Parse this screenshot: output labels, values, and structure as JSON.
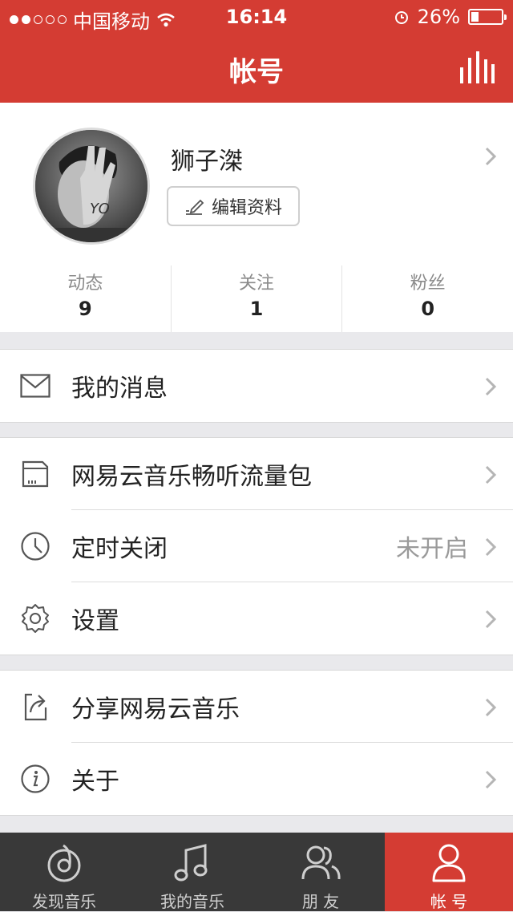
{
  "status_bar": {
    "carrier": "中国移动",
    "time": "16:14",
    "battery_percent": "26%",
    "battery_level": 0.26,
    "signal_bars_filled": 2,
    "signal_bars_total": 5
  },
  "nav": {
    "title": "帐号",
    "player_icon": "equalizer-icon"
  },
  "profile": {
    "username": "狮子滐",
    "edit_label": "编辑资料",
    "stats": [
      {
        "label": "动态",
        "value": "9"
      },
      {
        "label": "关注",
        "value": "1"
      },
      {
        "label": "粉丝",
        "value": "0"
      }
    ]
  },
  "menu": {
    "messages": {
      "label": "我的消息",
      "icon": "envelope-icon"
    },
    "data_pack": {
      "label": "网易云音乐畅听流量包",
      "icon": "sim-card-icon"
    },
    "sleep_timer": {
      "label": "定时关闭",
      "value": "未开启",
      "icon": "clock-icon"
    },
    "settings": {
      "label": "设置",
      "icon": "gear-icon"
    },
    "share": {
      "label": "分享网易云音乐",
      "icon": "share-icon"
    },
    "about": {
      "label": "关于",
      "icon": "info-icon"
    }
  },
  "tabs": [
    {
      "label": "发现音乐",
      "icon": "discover-icon"
    },
    {
      "label": "我的音乐",
      "icon": "music-note-icon"
    },
    {
      "label": "朋 友",
      "icon": "friends-icon"
    },
    {
      "label": "帐 号",
      "icon": "account-icon",
      "active": true
    }
  ],
  "colors": {
    "accent": "#d43c33",
    "tabbar": "#393939",
    "background": "#e9e9ec"
  }
}
